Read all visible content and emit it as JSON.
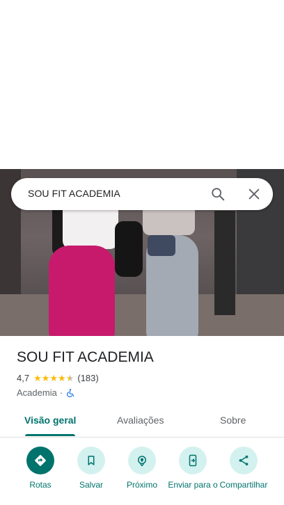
{
  "search": {
    "query": "SOU FIT ACADEMIA"
  },
  "place": {
    "title": "SOU FIT ACADEMIA",
    "rating": "4,7",
    "stars": 4.5,
    "review_count": "(183)",
    "category": "Academia",
    "separator": "·"
  },
  "tabs": [
    {
      "label": "Visão geral"
    },
    {
      "label": "Avaliações"
    },
    {
      "label": "Sobre"
    }
  ],
  "actions": [
    {
      "label": "Rotas"
    },
    {
      "label": "Salvar"
    },
    {
      "label": "Próximo"
    },
    {
      "label": "Enviar para o"
    },
    {
      "label": "Compartilhar"
    }
  ],
  "colors": {
    "accent": "#00736c",
    "accent_light": "#d3f1ef",
    "star": "#fbbc04"
  }
}
